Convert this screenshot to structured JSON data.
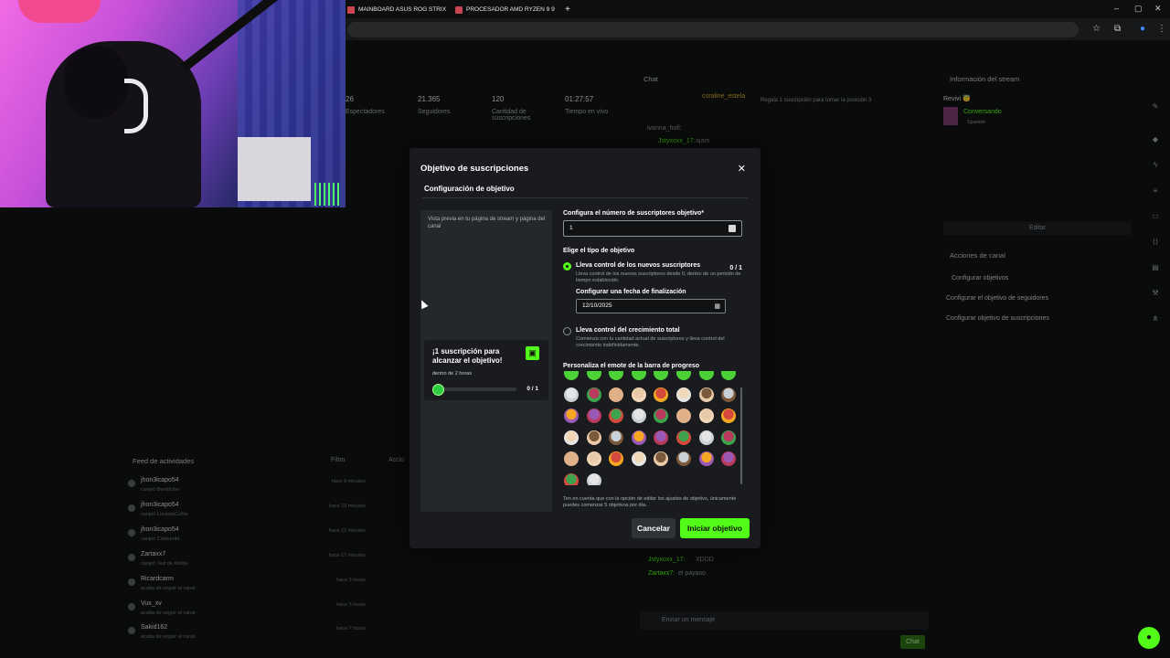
{
  "browser": {
    "tabs": [
      {
        "title": "MAINBOARD ASUS ROG STRIX"
      },
      {
        "title": "PROCESADOR AMD RYZEN 9 9"
      }
    ],
    "new_tab": "+"
  },
  "dashboard": {
    "stats": [
      {
        "value": "26",
        "label": "Espectadores"
      },
      {
        "value": "21.365",
        "label": "Seguidores"
      },
      {
        "value": "120",
        "label": "Cantidad de suscripciones"
      },
      {
        "value": "01:27:57",
        "label": "Tiempo en vivo"
      }
    ],
    "chat_title": "Chat",
    "chat_pinned_user": "coraline_estela",
    "chat_pinned_note": "Regala 1 suscripción para tomar la posición 3",
    "chat_messages": [
      {
        "user": "ivanna_hofi:",
        "text": ""
      },
      {
        "user": "Jstyxoxx_17:",
        "text": "ajam"
      },
      {
        "user": "Jstyxoxx_17:",
        "text": "XDDD"
      },
      {
        "user": "Zartaxx7:",
        "text": "el payaso"
      }
    ],
    "chat_input_placeholder": "Enviar un mensaje",
    "chat_send": "Chat",
    "stream_info_title": "Información del stream",
    "stream_info_name": "Revivi 😇",
    "stream_info_category": "Conversando",
    "stream_info_lang": "Spanish",
    "edit_button": "Editar",
    "channel_actions_title": "Acciones de canal",
    "channel_actions": [
      "Configurar objetivos",
      "Configurar el objetivo de seguidores",
      "Configurar objetivo de suscripciones"
    ],
    "feed_title": "Feed de actividades",
    "feed_filter": "Filtro",
    "feed_actions": "Accio",
    "feed": [
      {
        "name": "jhon3icapo54",
        "sub": "canjeó Bendición",
        "time": "hace 8 minutos"
      },
      {
        "name": "jhon3icapo54",
        "sub": "canjeó LucasteColita",
        "time": "hace 10 minutos"
      },
      {
        "name": "jhon3icapo54",
        "sub": "canjeó Calaverita",
        "time": "hace 12 minutos"
      },
      {
        "name": "Zartaxx7",
        "sub": "canjeó Ved de Amble",
        "time": "hace 17 minutos"
      },
      {
        "name": "Ricardcarm",
        "sub": "acaba de seguir al canal",
        "time": "hace 3 horas"
      },
      {
        "name": "Vux_xv",
        "sub": "acaba de seguir al canal",
        "time": "hace 5 horas"
      },
      {
        "name": "Sakid162",
        "sub": "acaba de seguir al canal",
        "time": "hace 7 horas"
      }
    ],
    "colors": {
      "brand": "#53fc18",
      "modal_bg": "#191b1f"
    }
  },
  "modal": {
    "title": "Objetivo de suscripciones",
    "close_icon": "close-icon",
    "section": "Configuración de objetivo",
    "preview_text": "Vista previa en tu página de stream y página del canal",
    "preview_card": {
      "title": "¡1 suscripción para alcanzar el objetivo!",
      "subtitle": "dentro de 2 horas",
      "count": "0 / 1",
      "progress": 0
    },
    "target_label": "Configura el número de suscriptores objetivo*",
    "target_value": "1",
    "type_label": "Elige el tipo de objetivo",
    "option_new": {
      "title": "Lleva control de los nuevos suscriptores",
      "desc": "Lleva control de los nuevos suscriptores desde 0, dentro de un periodo de tiempo establecido.",
      "count": "0 / 1",
      "selected": true
    },
    "end_date_label": "Configurar una fecha de finalización",
    "end_date_value": "12/10/2025",
    "option_total": {
      "title": "Lleva control del crecimiento total",
      "desc": "Comienza con tu cantidad actual de suscriptores y lleva control del crecimiento indefinidamente.",
      "selected": false
    },
    "emote_label": "Personaliza el emote de la barra de progreso",
    "note": "Ten en cuenta que con la opción de editar los ajustes de objetivo, únicamente puedes comenzar 5 objetivos por día.",
    "cancel": "Cancelar",
    "start": "Iniciar objetivo"
  }
}
